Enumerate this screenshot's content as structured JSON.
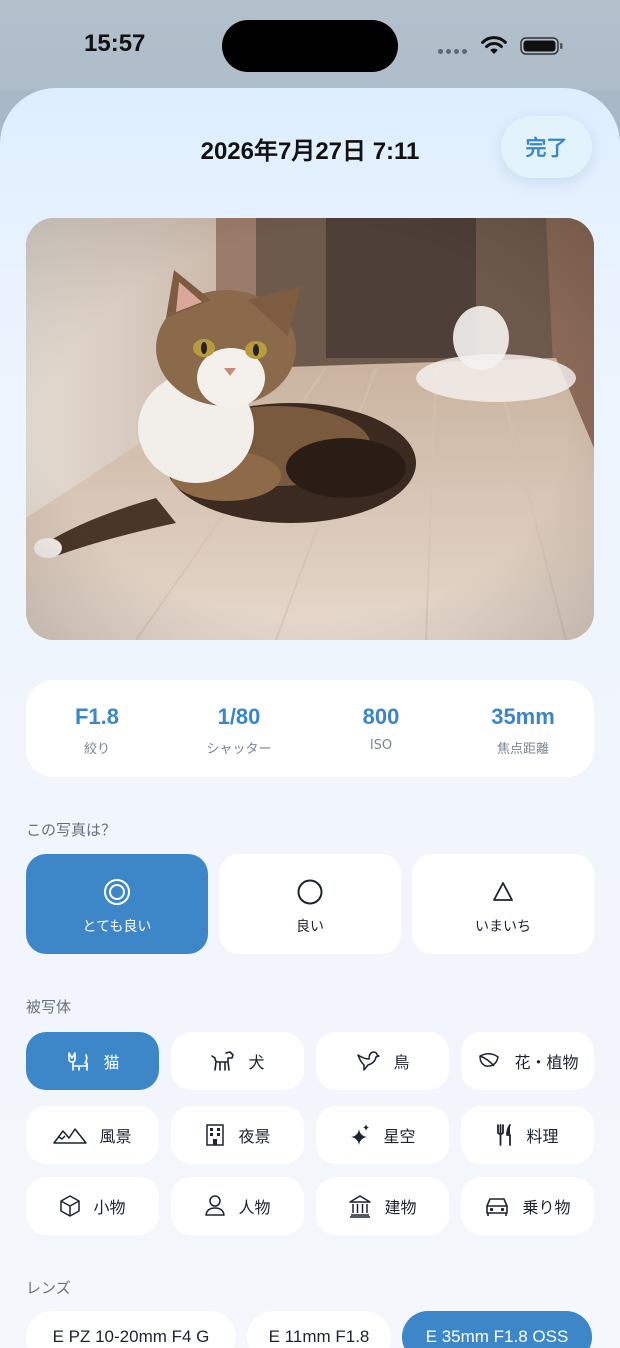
{
  "status": {
    "time": "15:57"
  },
  "sheet": {
    "title": "2026年7月27日 7:11",
    "done_label": "完了"
  },
  "exif": [
    {
      "value": "F1.8",
      "label": "絞り"
    },
    {
      "value": "1/80",
      "label": "シャッター"
    },
    {
      "value": "800",
      "label": "ISO"
    },
    {
      "value": "35mm",
      "label": "焦点距離"
    }
  ],
  "rating": {
    "label": "この写真は？",
    "options": [
      {
        "label": "とても良い",
        "icon": "double-circle-icon",
        "selected": true
      },
      {
        "label": "良い",
        "icon": "circle-icon",
        "selected": false
      },
      {
        "label": "いまいち",
        "icon": "triangle-icon",
        "selected": false
      }
    ]
  },
  "subjects": {
    "label": "被写体",
    "items": [
      {
        "label": "猫",
        "icon": "cat-icon",
        "selected": true
      },
      {
        "label": "犬",
        "icon": "dog-icon",
        "selected": false
      },
      {
        "label": "鳥",
        "icon": "bird-icon",
        "selected": false
      },
      {
        "label": "花・植物",
        "icon": "leaf-icon",
        "selected": false
      },
      {
        "label": "風景",
        "icon": "mountains-icon",
        "selected": false
      },
      {
        "label": "夜景",
        "icon": "building-icon",
        "selected": false
      },
      {
        "label": "星空",
        "icon": "sparkles-icon",
        "selected": false
      },
      {
        "label": "料理",
        "icon": "fork-knife-icon",
        "selected": false
      },
      {
        "label": "小物",
        "icon": "cube-icon",
        "selected": false
      },
      {
        "label": "人物",
        "icon": "person-icon",
        "selected": false
      },
      {
        "label": "建物",
        "icon": "bank-icon",
        "selected": false
      },
      {
        "label": "乗り物",
        "icon": "car-icon",
        "selected": false
      }
    ]
  },
  "lenses": {
    "label": "レンズ",
    "items": [
      {
        "label": "E PZ 10-20mm F4 G",
        "selected": false
      },
      {
        "label": "E 11mm F1.8",
        "selected": false
      },
      {
        "label": "E 35mm F1.8 OSS",
        "selected": true
      }
    ]
  },
  "colors": {
    "accent": "#3d86c8",
    "accent_text": "#3a86c7"
  }
}
